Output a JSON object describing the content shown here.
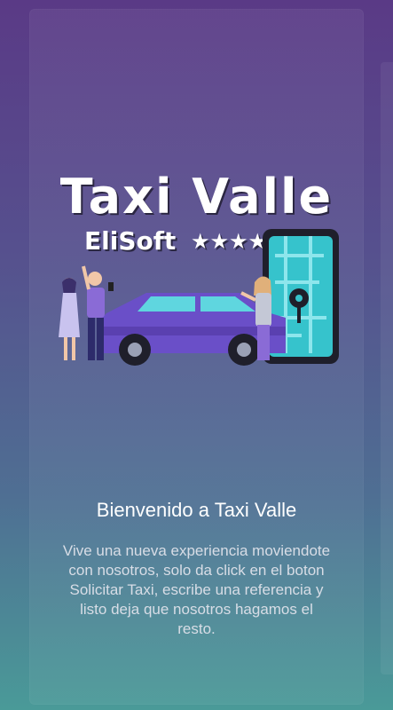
{
  "logo": {
    "title": "Taxi Valle",
    "subtitle": "EliSoft",
    "stars": "★★★★★"
  },
  "welcome": {
    "heading": "Bienvenido a Taxi Valle",
    "description": "Vive una nueva experiencia moviendote con nosotros, solo da click en el boton Solicitar Taxi, escribe una referencia y listo deja que nosotros hagamos el resto."
  },
  "colors": {
    "car": "#6a4fc8",
    "phone_screen": "#36c3cc",
    "accent_cyan": "#5fd6df"
  }
}
